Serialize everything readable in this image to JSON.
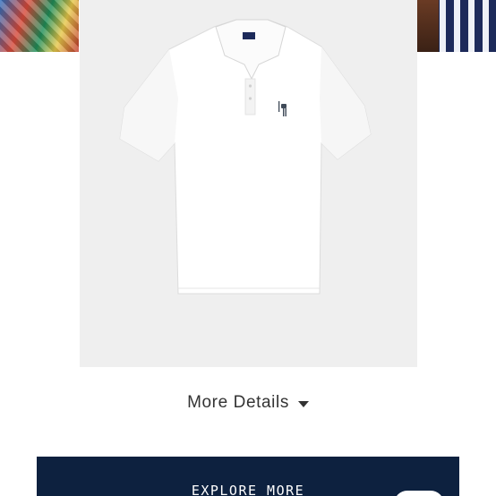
{
  "colors": {
    "card_background": "#efefef",
    "shirt": "#ffffff",
    "logo": "#3f4a58",
    "details_text": "#333333",
    "explore_background": "#0d213f",
    "explore_text": "#ffffff"
  },
  "product": {
    "image_icon": "white-polo-shirt-icon"
  },
  "details": {
    "label": "More Details",
    "caret_icon": "caret-down-icon"
  },
  "explore": {
    "label": "EXPLORE MORE"
  }
}
